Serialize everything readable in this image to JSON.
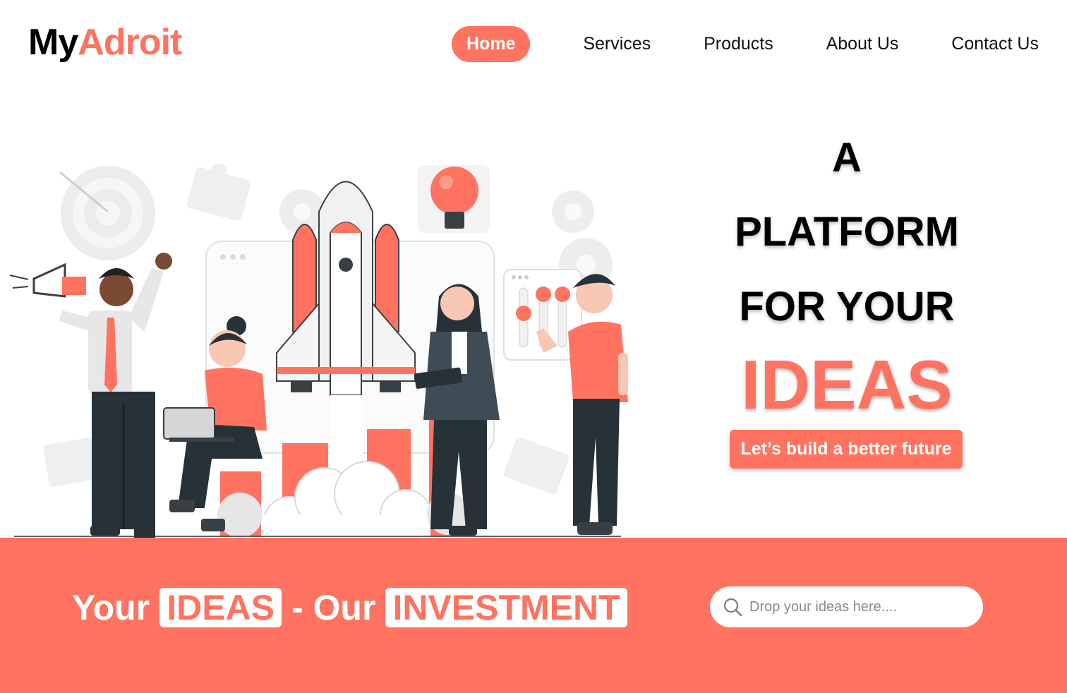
{
  "brand": {
    "part1": "My",
    "part2": "Adroit",
    "accent_color": "#ff7360"
  },
  "nav": {
    "items": [
      {
        "label": "Home",
        "active": true
      },
      {
        "label": "Services"
      },
      {
        "label": "Products"
      },
      {
        "label": "About Us"
      },
      {
        "label": "Contact Us"
      }
    ]
  },
  "hero": {
    "line1": "A",
    "line2": "PLATFORM",
    "line3": "FOR YOUR",
    "line4": "IDEAS",
    "cta_label": "Let’s build a better future"
  },
  "banner": {
    "word1": "Your",
    "word2": "IDEAS",
    "word3": "- Our",
    "word4": "INVESTMENT",
    "background_color": "#ff7360"
  },
  "search": {
    "placeholder": "Drop your ideas here....",
    "icon": "search-icon"
  },
  "illustration": {
    "name": "startup-launch-illustration"
  }
}
